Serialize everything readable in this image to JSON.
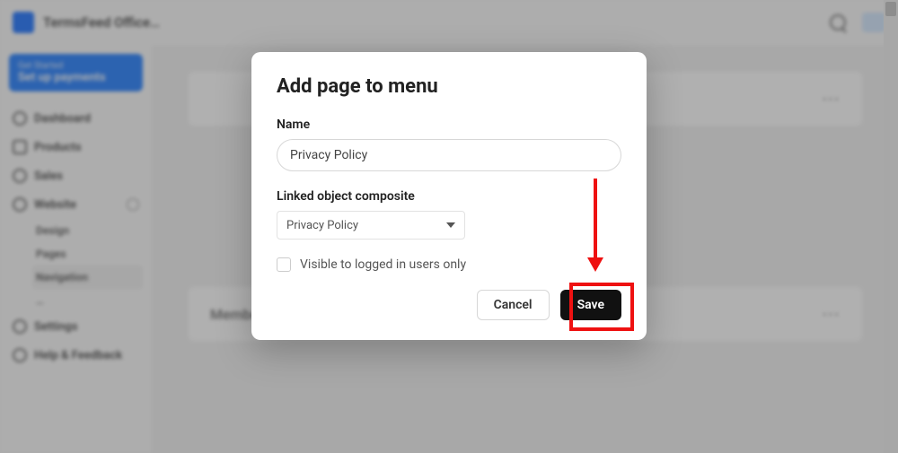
{
  "app": {
    "title": "TermsFeed Office…"
  },
  "topbar": {},
  "sidebar": {
    "promo": {
      "small": "Get Started",
      "main": "Set up payments"
    },
    "items": [
      {
        "label": "Dashboard"
      },
      {
        "label": "Products"
      },
      {
        "label": "Sales"
      },
      {
        "label": "Website"
      },
      {
        "label": "Settings"
      },
      {
        "label": "Help & Feedback"
      }
    ],
    "website_sub": [
      {
        "label": "Design"
      },
      {
        "label": "Pages"
      },
      {
        "label": "Navigation"
      },
      {
        "label": "…"
      }
    ]
  },
  "main": {
    "member_menu_title": "Member Menu"
  },
  "modal": {
    "title": "Add page to menu",
    "name_label": "Name",
    "name_value": "Privacy Policy",
    "linked_label": "Linked object composite",
    "linked_value": "Privacy Policy",
    "visible_label": "Visible to logged in users only",
    "cancel": "Cancel",
    "save": "Save"
  }
}
